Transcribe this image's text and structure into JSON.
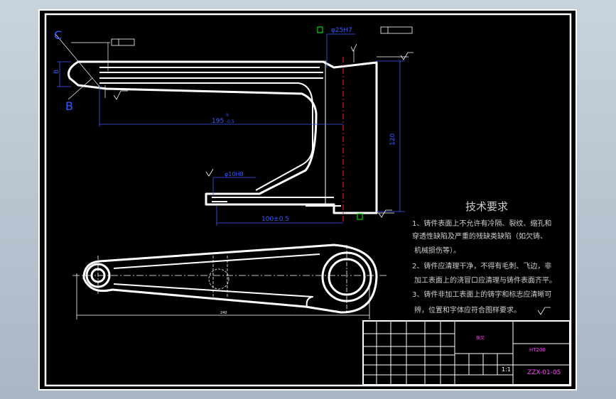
{
  "drawing": {
    "dimensions": {
      "length_top": "195",
      "length_top_tol": "0\n-0.5",
      "height_right": "120",
      "height_right_tol": "0\n-0.5",
      "bottom_len": "100±0.5",
      "bore_top": "φ25H7",
      "bore_small": "φ10H8",
      "left_dim": "B"
    },
    "labels": {
      "c_label": "C",
      "b_label": "B",
      "a_datum": "A"
    },
    "tech_title": "技术要求",
    "tech_lines": [
      "1、铸件表面上不允许有冷隔、裂纹、缩孔和",
      "穿透性缺陷及严重的残缺类缺陷（如欠铸、",
      "机械损伤等）。",
      "2、铸件应清理干净，不得有毛刺、飞边，非",
      "加工表面上的浇冒口应清理与铸件表面齐平。",
      "3、铸件非加工表面上的铸字和标志应清晰可",
      "辨，位置和字体应符合图样要求。"
    ],
    "title_block": {
      "material": "HT200",
      "drawing_no": "ZZX-01-05",
      "scale": "1:1",
      "part_name": "拨叉"
    }
  }
}
